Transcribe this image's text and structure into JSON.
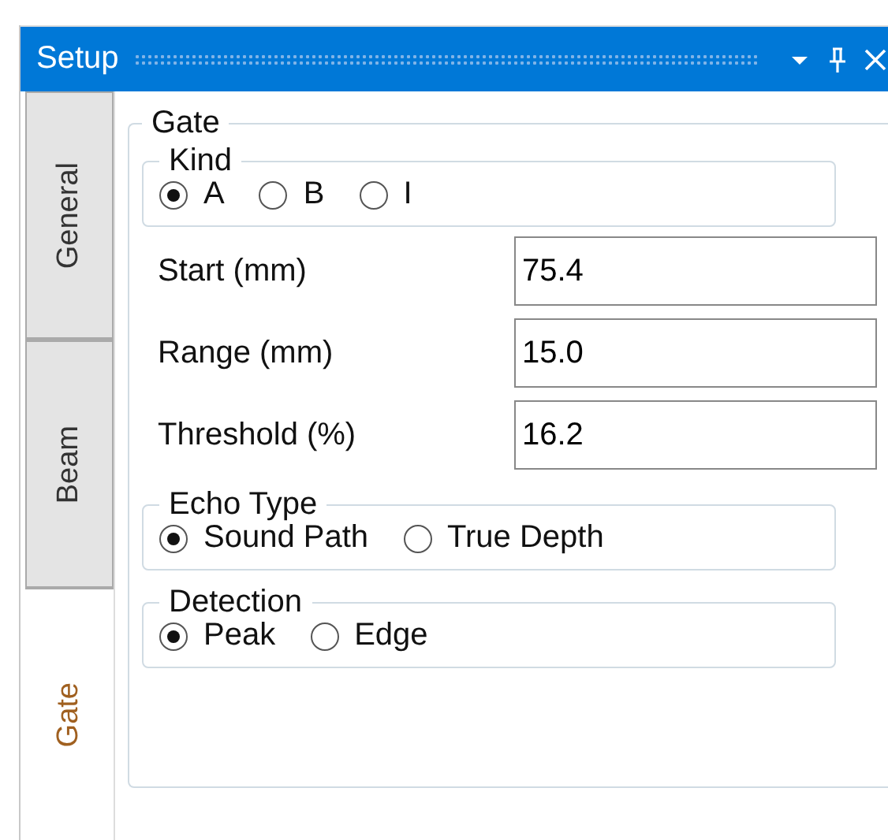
{
  "window": {
    "title": "Setup"
  },
  "tabs": [
    {
      "label": "General",
      "selected": false
    },
    {
      "label": "Beam",
      "selected": false
    },
    {
      "label": "Gate",
      "selected": true
    }
  ],
  "gate": {
    "title": "Gate",
    "kind": {
      "title": "Kind",
      "options": [
        {
          "label": "A",
          "selected": true
        },
        {
          "label": "B",
          "selected": false
        },
        {
          "label": "I",
          "selected": false
        }
      ]
    },
    "fields": [
      {
        "label": "Start (mm)",
        "value": "75.4"
      },
      {
        "label": "Range (mm)",
        "value": "15.0"
      },
      {
        "label": "Threshold (%)",
        "value": "16.2"
      }
    ],
    "echo_type": {
      "title": "Echo Type",
      "options": [
        {
          "label": "Sound Path",
          "selected": true
        },
        {
          "label": "True Depth",
          "selected": false
        }
      ]
    },
    "detection": {
      "title": "Detection",
      "options": [
        {
          "label": "Peak",
          "selected": true
        },
        {
          "label": "Edge",
          "selected": false
        }
      ]
    }
  }
}
